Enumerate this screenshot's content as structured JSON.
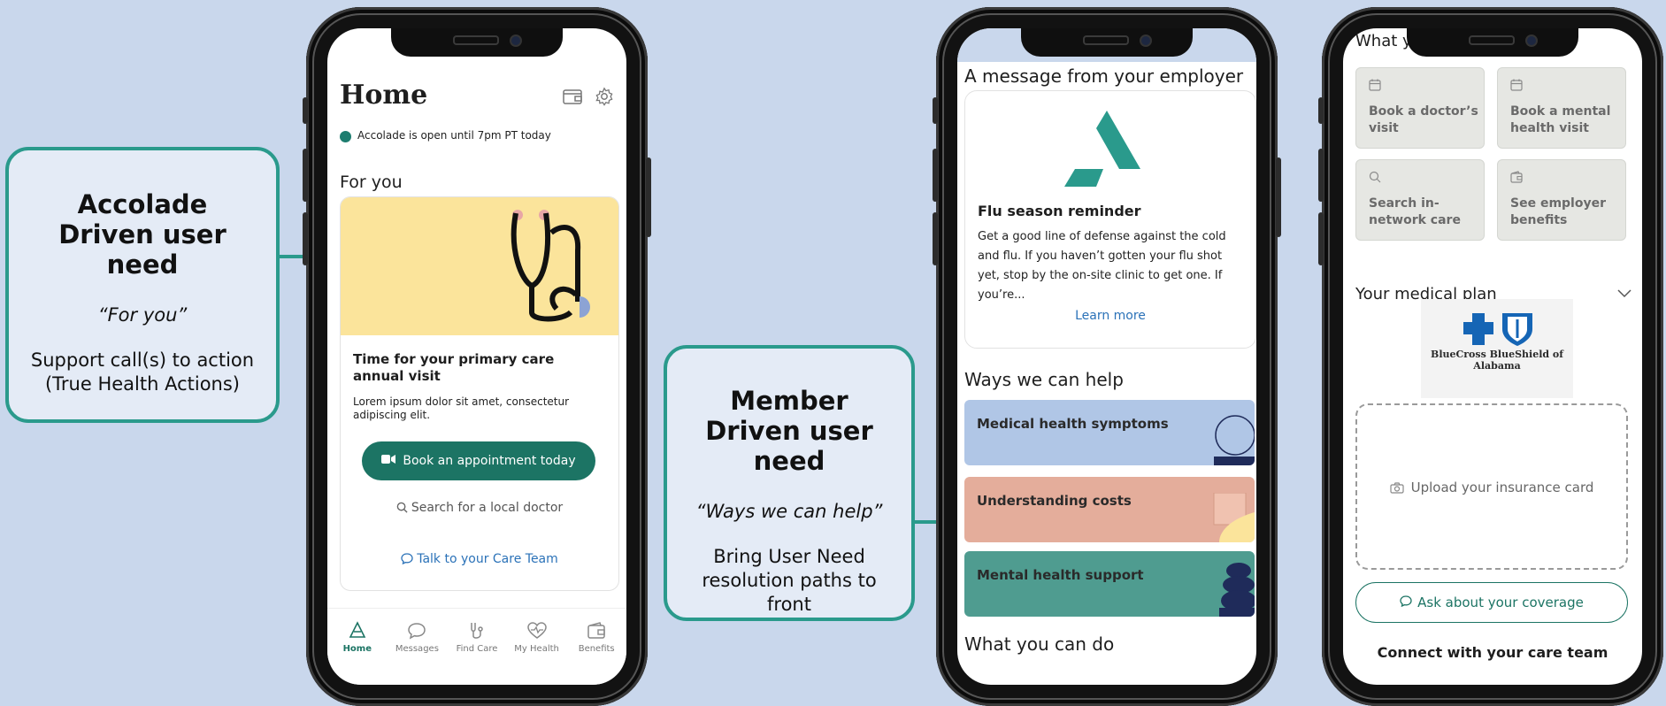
{
  "callouts": {
    "accolade": {
      "title": "Accolade Driven user need",
      "quote": "“For you”",
      "description": "Support call(s) to action (True Health Actions)"
    },
    "member": {
      "title": "Member Driven user need",
      "quote": "“Ways we can help”",
      "description": "Bring User Need resolution paths to front"
    }
  },
  "home_screen": {
    "title": "Home",
    "status_text": "Accolade is open until 7pm PT today",
    "section_title": "For you",
    "card": {
      "title": "Time for your primary care annual visit",
      "description": "Lorem ipsum dolor sit amet, consectetur adipiscing elit.",
      "primary_action": "Book an appointment today",
      "secondary_action": "Search for a local doctor",
      "tertiary_action": "Talk to your Care Team"
    },
    "tabs": [
      {
        "label": "Home",
        "icon": "home-icon",
        "active": true
      },
      {
        "label": "Messages",
        "icon": "messages-icon",
        "active": false
      },
      {
        "label": "Find Care",
        "icon": "stethoscope-icon",
        "active": false
      },
      {
        "label": "My Health",
        "icon": "heart-icon",
        "active": false
      },
      {
        "label": "Benefits",
        "icon": "wallet-icon",
        "active": false
      }
    ],
    "icons": {
      "wallet": "wallet-icon",
      "settings": "gear-icon"
    }
  },
  "employer_screen": {
    "message_heading": "A message from your employer",
    "message": {
      "title": "Flu season reminder",
      "body": "Get a good line of defense against the cold and flu. If you haven’t gotten your flu shot yet, stop by the on-site clinic to get one. If you’re...",
      "link": "Learn more"
    },
    "help_heading": "Ways we can help",
    "help_items": [
      {
        "label": "Medical health symptoms",
        "color": "#b0c6e6"
      },
      {
        "label": "Understanding costs",
        "color": "#e4ad9b"
      },
      {
        "label": "Mental health support",
        "color": "#4f9c90"
      }
    ],
    "footer_heading": "What you can do"
  },
  "plan_screen": {
    "top_heading": "What y",
    "actions": [
      {
        "label": "Book a doctor’s visit",
        "icon": "calendar-icon"
      },
      {
        "label": "Book a mental health visit",
        "icon": "calendar-icon"
      },
      {
        "label": "Search in-network care",
        "icon": "search-icon"
      },
      {
        "label": "See employer benefits",
        "icon": "wallet-icon"
      }
    ],
    "plan_title": "Your medical plan",
    "insurer": "BlueCross BlueShield of Alabama",
    "upload_label": "Upload your insurance card",
    "ask_button": "Ask about your coverage",
    "bottom_heading": "Connect with your care team"
  },
  "colors": {
    "background": "#c9d7ec",
    "accent": "#2a9a8c",
    "primary_button": "#1c7464",
    "link": "#2b72b8"
  }
}
